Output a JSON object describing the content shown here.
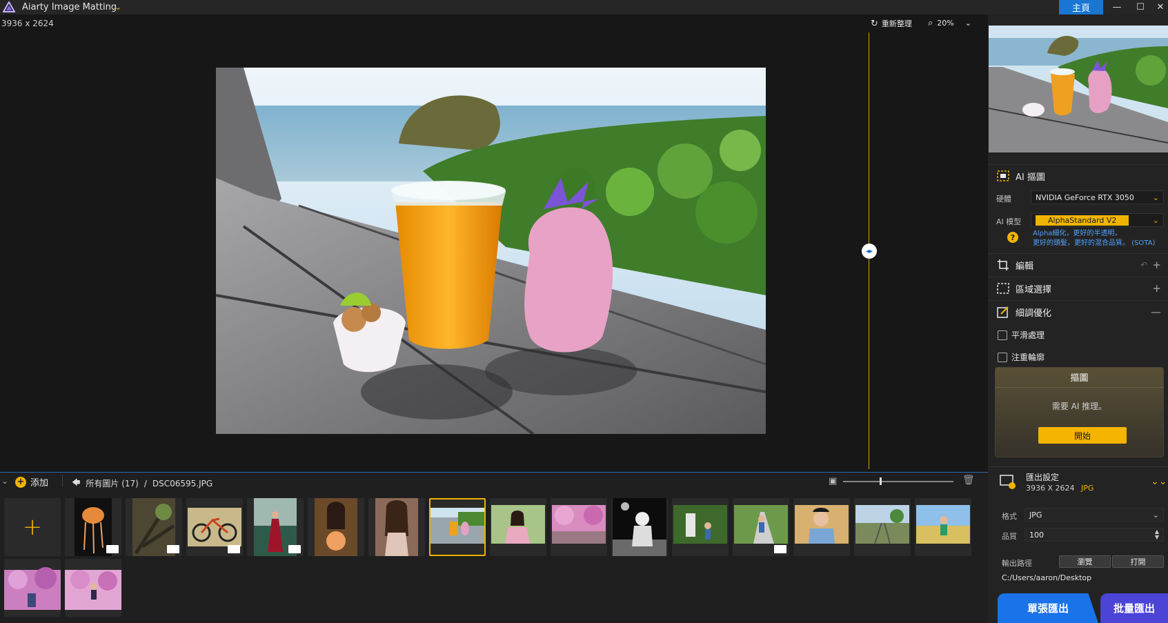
{
  "app": {
    "title": "Aiarty Image Matting",
    "home_label": "主頁"
  },
  "canvas": {
    "image_size": "3936 x 2624",
    "refresh_label": "重新整理",
    "zoom": "20%"
  },
  "filmstrip": {
    "add_label": "添加",
    "breadcrumb_all": "所有圖片 (17)",
    "breadcrumb_sep": "/",
    "breadcrumb_file": "DSC06595.JPG",
    "selected_index": 6
  },
  "right": {
    "ai_section": "AI 摳圖",
    "hardware_label": "硬體",
    "hardware_value": "NVIDIA GeForce RTX 3050",
    "model_label": "AI 模型",
    "model_value": "AlphaStandard  V2",
    "model_desc_1": "Alpha細化，更好的半透明，",
    "model_desc_2": "更好的頭髮，更好的混合品質。",
    "model_desc_tag": "(SOTA)",
    "edit_section": "編輯",
    "region_section": "區域選擇",
    "refine_section": "細調優化",
    "smooth_label": "平滑處理",
    "edge_label": "注重輪廓",
    "matte_title": "摳圖",
    "matte_note": "需要 AI 推理。",
    "start_label": "開始",
    "export_title": "匯出設定",
    "export_size": "3936 X 2624",
    "export_fmt_short": "JPG",
    "format_label": "格式",
    "format_value": "JPG",
    "quality_label": "品質",
    "quality_value": "100",
    "path_label": "輸出路徑",
    "browse_label": "瀏覽",
    "open_label": "打開",
    "path_value": "C:/Users/aaron/Desktop",
    "single_export": "單張匯出",
    "batch_export": "批量匯出"
  },
  "colors": {
    "accent": "#f0b400",
    "primary": "#1976d2",
    "batch": "#4b44d6"
  }
}
